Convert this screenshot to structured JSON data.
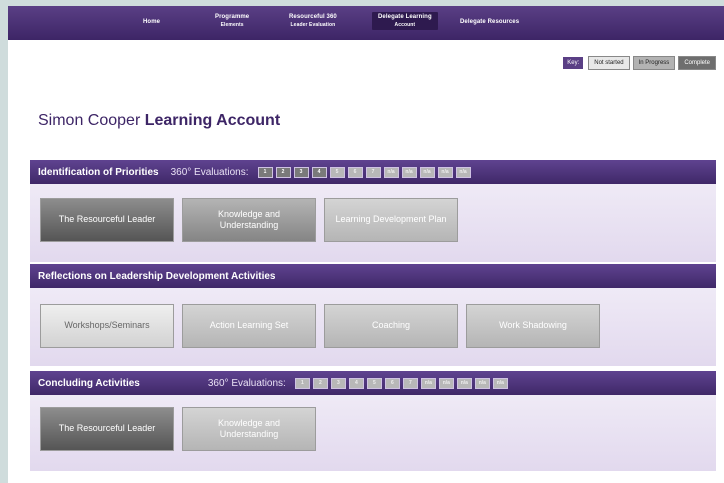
{
  "nav": {
    "home": "Home",
    "programme": "Programme",
    "programme_sub": "Elements",
    "resourceful360": "Resourceful 360",
    "resourceful360_sub": "Leader Evaluation",
    "delegate_learning": "Delegate Learning",
    "delegate_learning_sub": "Account",
    "delegate_resources": "Delegate Resources"
  },
  "key": {
    "label": "Key:",
    "not_started": "Not started",
    "in_progress": "In Progress",
    "complete": "Complete"
  },
  "page": {
    "name": "Simon Cooper",
    "title_suffix": "Learning Account"
  },
  "sections": {
    "identification": {
      "title": "Identification of Priorities",
      "eval_label": "360° Evaluations:",
      "evals": [
        "1",
        "2",
        "3",
        "4",
        "5",
        "6",
        "7",
        "n/a",
        "n/a",
        "n/a",
        "n/a",
        "n/a"
      ],
      "tiles": [
        "The Resourceful Leader",
        "Knowledge and Understanding",
        "Learning Development Plan"
      ]
    },
    "reflections": {
      "title": "Reflections on Leadership Development Activities",
      "tiles": [
        "Workshops/Seminars",
        "Action Learning Set",
        "Coaching",
        "Work Shadowing"
      ]
    },
    "concluding": {
      "title": "Concluding Activities",
      "eval_label": "360° Evaluations:",
      "evals": [
        "1",
        "2",
        "3",
        "4",
        "5",
        "6",
        "7",
        "n/a",
        "n/a",
        "n/a",
        "n/a",
        "n/a"
      ],
      "tiles": [
        "The Resourceful Leader",
        "Knowledge and Understanding"
      ]
    }
  },
  "colors": {
    "brand_purple": "#4a2f75",
    "not_started": "#e8e8e8",
    "in_progress": "#b3b3b3",
    "complete": "#6e6e6e"
  }
}
